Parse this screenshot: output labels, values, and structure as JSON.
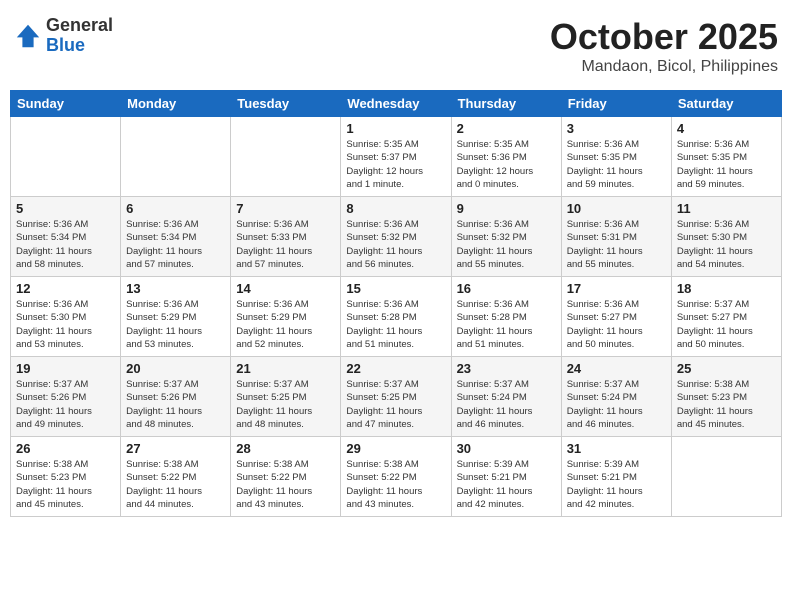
{
  "header": {
    "logo_general": "General",
    "logo_blue": "Blue",
    "month": "October 2025",
    "location": "Mandaon, Bicol, Philippines"
  },
  "weekdays": [
    "Sunday",
    "Monday",
    "Tuesday",
    "Wednesday",
    "Thursday",
    "Friday",
    "Saturday"
  ],
  "weeks": [
    [
      {
        "day": "",
        "info": ""
      },
      {
        "day": "",
        "info": ""
      },
      {
        "day": "",
        "info": ""
      },
      {
        "day": "1",
        "info": "Sunrise: 5:35 AM\nSunset: 5:37 PM\nDaylight: 12 hours\nand 1 minute."
      },
      {
        "day": "2",
        "info": "Sunrise: 5:35 AM\nSunset: 5:36 PM\nDaylight: 12 hours\nand 0 minutes."
      },
      {
        "day": "3",
        "info": "Sunrise: 5:36 AM\nSunset: 5:35 PM\nDaylight: 11 hours\nand 59 minutes."
      },
      {
        "day": "4",
        "info": "Sunrise: 5:36 AM\nSunset: 5:35 PM\nDaylight: 11 hours\nand 59 minutes."
      }
    ],
    [
      {
        "day": "5",
        "info": "Sunrise: 5:36 AM\nSunset: 5:34 PM\nDaylight: 11 hours\nand 58 minutes."
      },
      {
        "day": "6",
        "info": "Sunrise: 5:36 AM\nSunset: 5:34 PM\nDaylight: 11 hours\nand 57 minutes."
      },
      {
        "day": "7",
        "info": "Sunrise: 5:36 AM\nSunset: 5:33 PM\nDaylight: 11 hours\nand 57 minutes."
      },
      {
        "day": "8",
        "info": "Sunrise: 5:36 AM\nSunset: 5:32 PM\nDaylight: 11 hours\nand 56 minutes."
      },
      {
        "day": "9",
        "info": "Sunrise: 5:36 AM\nSunset: 5:32 PM\nDaylight: 11 hours\nand 55 minutes."
      },
      {
        "day": "10",
        "info": "Sunrise: 5:36 AM\nSunset: 5:31 PM\nDaylight: 11 hours\nand 55 minutes."
      },
      {
        "day": "11",
        "info": "Sunrise: 5:36 AM\nSunset: 5:30 PM\nDaylight: 11 hours\nand 54 minutes."
      }
    ],
    [
      {
        "day": "12",
        "info": "Sunrise: 5:36 AM\nSunset: 5:30 PM\nDaylight: 11 hours\nand 53 minutes."
      },
      {
        "day": "13",
        "info": "Sunrise: 5:36 AM\nSunset: 5:29 PM\nDaylight: 11 hours\nand 53 minutes."
      },
      {
        "day": "14",
        "info": "Sunrise: 5:36 AM\nSunset: 5:29 PM\nDaylight: 11 hours\nand 52 minutes."
      },
      {
        "day": "15",
        "info": "Sunrise: 5:36 AM\nSunset: 5:28 PM\nDaylight: 11 hours\nand 51 minutes."
      },
      {
        "day": "16",
        "info": "Sunrise: 5:36 AM\nSunset: 5:28 PM\nDaylight: 11 hours\nand 51 minutes."
      },
      {
        "day": "17",
        "info": "Sunrise: 5:36 AM\nSunset: 5:27 PM\nDaylight: 11 hours\nand 50 minutes."
      },
      {
        "day": "18",
        "info": "Sunrise: 5:37 AM\nSunset: 5:27 PM\nDaylight: 11 hours\nand 50 minutes."
      }
    ],
    [
      {
        "day": "19",
        "info": "Sunrise: 5:37 AM\nSunset: 5:26 PM\nDaylight: 11 hours\nand 49 minutes."
      },
      {
        "day": "20",
        "info": "Sunrise: 5:37 AM\nSunset: 5:26 PM\nDaylight: 11 hours\nand 48 minutes."
      },
      {
        "day": "21",
        "info": "Sunrise: 5:37 AM\nSunset: 5:25 PM\nDaylight: 11 hours\nand 48 minutes."
      },
      {
        "day": "22",
        "info": "Sunrise: 5:37 AM\nSunset: 5:25 PM\nDaylight: 11 hours\nand 47 minutes."
      },
      {
        "day": "23",
        "info": "Sunrise: 5:37 AM\nSunset: 5:24 PM\nDaylight: 11 hours\nand 46 minutes."
      },
      {
        "day": "24",
        "info": "Sunrise: 5:37 AM\nSunset: 5:24 PM\nDaylight: 11 hours\nand 46 minutes."
      },
      {
        "day": "25",
        "info": "Sunrise: 5:38 AM\nSunset: 5:23 PM\nDaylight: 11 hours\nand 45 minutes."
      }
    ],
    [
      {
        "day": "26",
        "info": "Sunrise: 5:38 AM\nSunset: 5:23 PM\nDaylight: 11 hours\nand 45 minutes."
      },
      {
        "day": "27",
        "info": "Sunrise: 5:38 AM\nSunset: 5:22 PM\nDaylight: 11 hours\nand 44 minutes."
      },
      {
        "day": "28",
        "info": "Sunrise: 5:38 AM\nSunset: 5:22 PM\nDaylight: 11 hours\nand 43 minutes."
      },
      {
        "day": "29",
        "info": "Sunrise: 5:38 AM\nSunset: 5:22 PM\nDaylight: 11 hours\nand 43 minutes."
      },
      {
        "day": "30",
        "info": "Sunrise: 5:39 AM\nSunset: 5:21 PM\nDaylight: 11 hours\nand 42 minutes."
      },
      {
        "day": "31",
        "info": "Sunrise: 5:39 AM\nSunset: 5:21 PM\nDaylight: 11 hours\nand 42 minutes."
      },
      {
        "day": "",
        "info": ""
      }
    ]
  ]
}
